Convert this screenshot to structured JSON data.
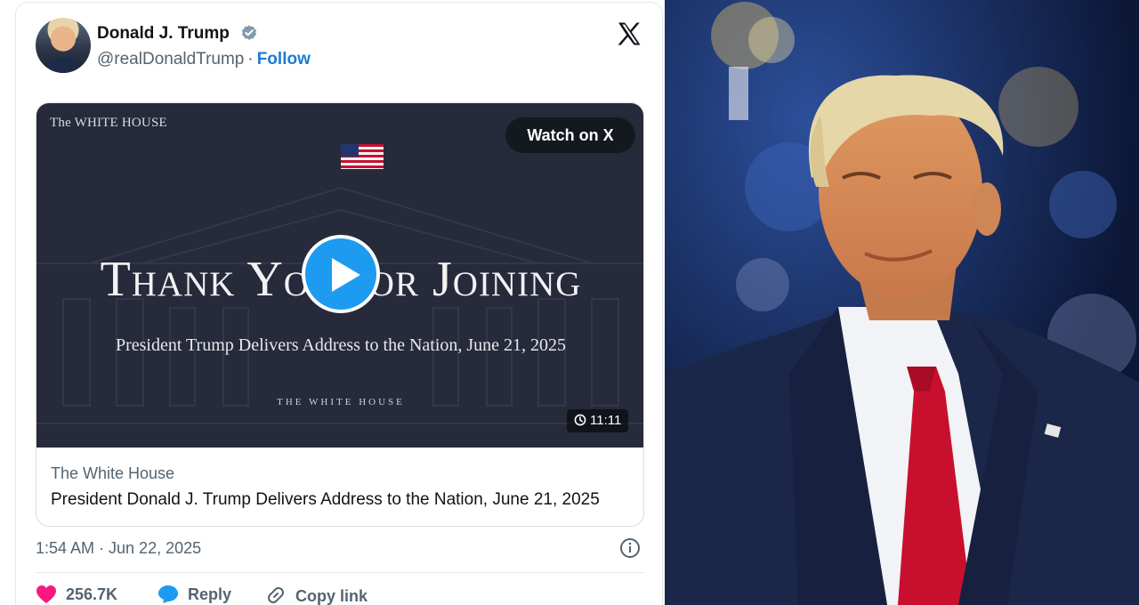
{
  "tweet": {
    "user_name": "Donald J. Trump",
    "handle": "@realDonaldTrump",
    "separator": "·",
    "follow_label": "Follow",
    "media": {
      "watch_label": "Watch on X",
      "header_logo": "The WHITE HOUSE",
      "video_title": "Thank You for Joining",
      "video_subtitle": "President Trump Delivers Address to the Nation, June 21, 2025",
      "video_footer": "THE WHITE HOUSE",
      "duration": "11:11",
      "source": "The White House",
      "caption": "President Donald J. Trump Delivers Address to the Nation, June 21, 2025"
    },
    "timestamp": "1:54 AM · Jun 22, 2025",
    "actions": {
      "like_count": "256.7K",
      "reply_label": "Reply",
      "copy_label": "Copy link"
    }
  },
  "icons": [
    "verified-badge-icon",
    "x-logo-icon",
    "flag-icon",
    "play-icon",
    "clock-icon",
    "info-icon",
    "heart-icon",
    "reply-bubble-icon",
    "link-icon"
  ],
  "colors": {
    "accent_blue": "#1d9bf0",
    "follow_blue": "#1d7bd3",
    "like_pink": "#f91880",
    "video_bg": "#262a3a",
    "tie_red": "#c8102e"
  }
}
